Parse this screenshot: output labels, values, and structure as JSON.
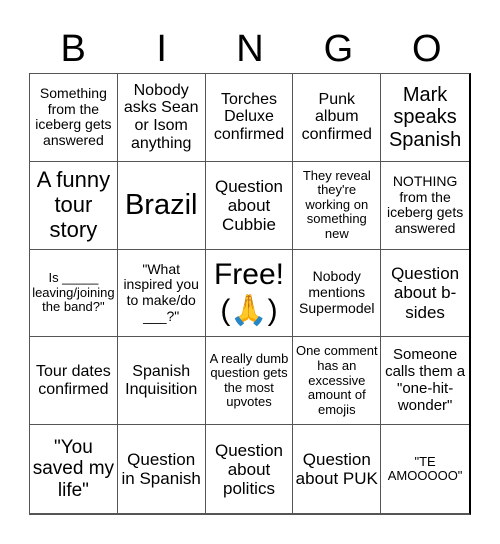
{
  "header": {
    "letters": [
      "B",
      "I",
      "N",
      "G",
      "O"
    ]
  },
  "cells": [
    "Something from the iceberg gets answered",
    "Nobody asks Sean or Isom anything",
    "Torches Deluxe confirmed",
    "Punk album confirmed",
    "Mark speaks Spanish",
    "A funny tour story",
    "Brazil",
    "Question about Cubbie",
    "They reveal they're working on something new",
    "NOTHING from the iceberg gets answered",
    "Is _____ leaving/joining the band?\"",
    "\"What inspired you to make/do ___?\"",
    "Free! (🙏)",
    "Nobody mentions Supermodel",
    "Question about b-sides",
    "Tour dates confirmed",
    "Spanish Inquisition",
    "A really dumb question gets the most upvotes",
    "One comment has an excessive amount of emojis",
    "Someone calls them a \"one-hit-wonder\"",
    "\"You saved my life\"",
    "Question in Spanish",
    "Question about politics",
    "Question about PUK",
    "\"TE AMOOOOO\""
  ]
}
